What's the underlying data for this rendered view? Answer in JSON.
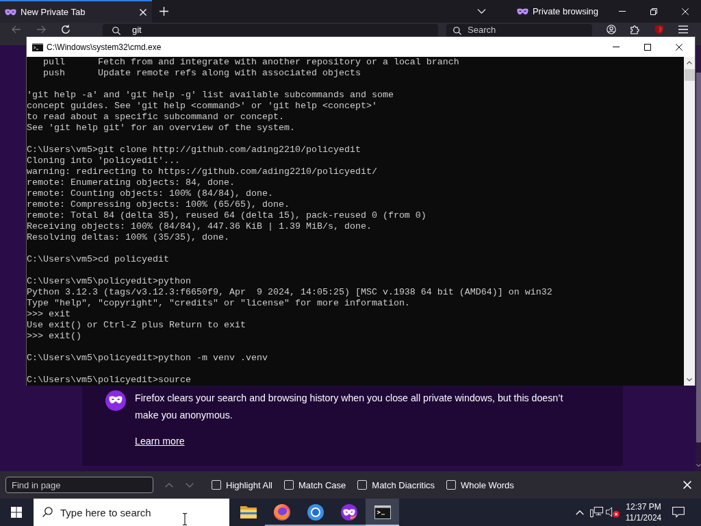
{
  "browser": {
    "tabs": [
      {
        "label": "New Private Tab",
        "selected": true
      }
    ],
    "private_indicator": "Private browsing",
    "back_disabled": true,
    "forward_disabled": true,
    "url_bar": {
      "value": "git"
    },
    "search_bar": {
      "placeholder": "Search"
    }
  },
  "terminal_window": {
    "title": "C:\\Windows\\system32\\cmd.exe",
    "blocks": [
      [
        "   pull      Fetch from and integrate with another repository or a local branch",
        "   push      Update remote refs along with associated objects"
      ],
      [
        "'git help -a' and 'git help -g' list available subcommands and some",
        "concept guides. See 'git help <command>' or 'git help <concept>'",
        "to read about a specific subcommand or concept.",
        "See 'git help git' for an overview of the system."
      ],
      [
        "C:\\Users\\vm5>git clone http://github.com/ading2210/policyedit",
        "Cloning into 'policyedit'...",
        "warning: redirecting to https://github.com/ading2210/policyedit/",
        "remote: Enumerating objects: 84, done.",
        "remote: Counting objects: 100% (84/84), done.",
        "remote: Compressing objects: 100% (65/65), done.",
        "remote: Total 84 (delta 35), reused 64 (delta 15), pack-reused 0 (from 0)",
        "Receiving objects: 100% (84/84), 447.36 KiB | 1.39 MiB/s, done.",
        "Resolving deltas: 100% (35/35), done."
      ],
      [
        "C:\\Users\\vm5>cd policyedit"
      ],
      [
        "C:\\Users\\vm5\\policyedit>python",
        "Python 3.12.3 (tags/v3.12.3:f6650f9, Apr  9 2024, 14:05:25) [MSC v.1938 64 bit (AMD64)] on win32",
        "Type \"help\", \"copyright\", \"credits\" or \"license\" for more information.",
        ">>> exit",
        "Use exit() or Ctrl-Z plus Return to exit",
        ">>> exit()"
      ],
      [
        "C:\\Users\\vm5\\policyedit>python -m venv .venv"
      ],
      [
        "C:\\Users\\vm5\\policyedit>source"
      ]
    ]
  },
  "private_notice": {
    "message": "Firefox clears your search and browsing history when you close all private windows, but this doesn’t make you anonymous.",
    "link": "Learn more"
  },
  "find_bar": {
    "placeholder": "Find in page",
    "nav_disabled": true,
    "options": [
      {
        "label": "Highlight All",
        "checked": false
      },
      {
        "label": "Match Case",
        "checked": false
      },
      {
        "label": "Match Diacritics",
        "checked": false
      },
      {
        "label": "Whole Words",
        "checked": false
      }
    ]
  },
  "taskbar": {
    "search_placeholder": "Type here to search",
    "apps": [
      {
        "kind": "files",
        "running": false,
        "active": false
      },
      {
        "kind": "browser",
        "running": true,
        "active": false
      },
      {
        "kind": "ring",
        "running": true,
        "active": false
      },
      {
        "kind": "private",
        "running": true,
        "active": false
      },
      {
        "kind": "terminal",
        "running": true,
        "active": true
      }
    ],
    "clock": {
      "time": "12:37 PM",
      "date": "11/1/2024"
    }
  }
}
